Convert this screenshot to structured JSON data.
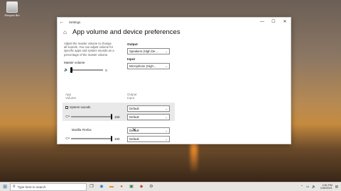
{
  "desktop": {
    "recycle_bin_label": "Recycle Bin"
  },
  "window": {
    "title": "Settings",
    "controls": {
      "minimize": "—",
      "maximize": "☐",
      "close": "✕"
    }
  },
  "page": {
    "title": "App volume and device preferences",
    "description": "Adjust the master volume to change all sounds. You can adjust volume for specific apps and system sounds as a percentage of the master volume.",
    "master_volume_label": "Master volume",
    "master_volume_value": "0",
    "output_label": "Output",
    "output_value": "Speakers (High De...",
    "input_label": "Input",
    "input_value": "Microphone (High...",
    "app_column_label": "App\nVolume",
    "output_column_label": "Output\nInput"
  },
  "apps": [
    {
      "name": "System sounds",
      "volume": "100",
      "output": "Default",
      "input": "Default"
    },
    {
      "name": "Mozilla Firefox",
      "volume": "100",
      "output": "Default",
      "input": "Default"
    }
  ],
  "taskbar": {
    "search_placeholder": "Type here to search",
    "time": "2:51 PM",
    "date": "1/30/2021"
  },
  "icons": {
    "start": "windows-logo-icon",
    "search": "search-icon",
    "back": "back-arrow-icon",
    "home": "home-icon"
  }
}
